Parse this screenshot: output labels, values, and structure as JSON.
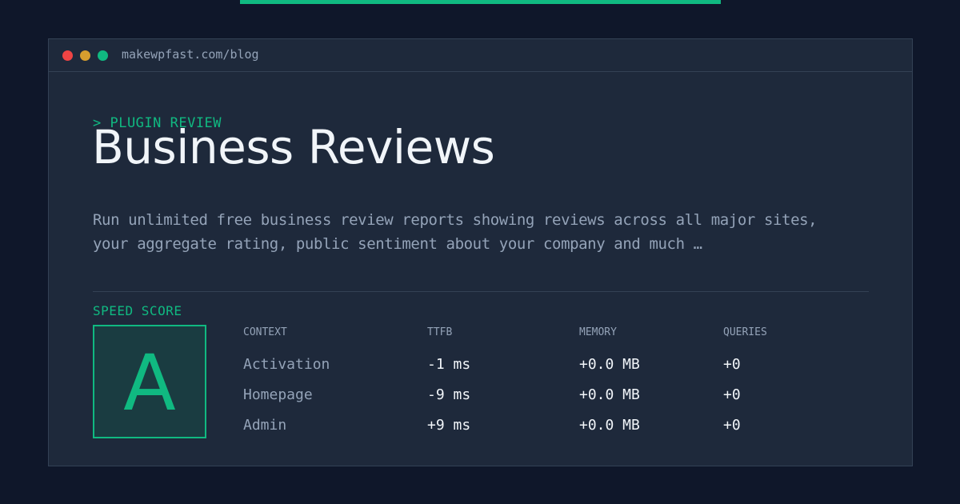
{
  "window": {
    "url": "makewpfast.com/blog"
  },
  "header": {
    "kicker": "> PLUGIN REVIEW",
    "title": "Business Reviews"
  },
  "description": "Run unlimited free business review reports showing reviews across all major sites, your aggregate rating, public sentiment about your company and much …",
  "speed": {
    "label": "SPEED SCORE",
    "grade": "A"
  },
  "table": {
    "headers": [
      "CONTEXT",
      "TTFB",
      "MEMORY",
      "QUERIES"
    ],
    "rows": [
      [
        "Activation",
        "-1 ms",
        "+0.0 MB",
        "+0"
      ],
      [
        "Homepage",
        "-9 ms",
        "+0.0 MB",
        "+0"
      ],
      [
        "Admin",
        "+9 ms",
        "+0.0 MB",
        "+0"
      ]
    ]
  },
  "colors": {
    "background": "#0f172a",
    "card": "#1e293b",
    "accent": "#10b981",
    "text": "#f1f5f9",
    "muted": "#94a3b8"
  }
}
